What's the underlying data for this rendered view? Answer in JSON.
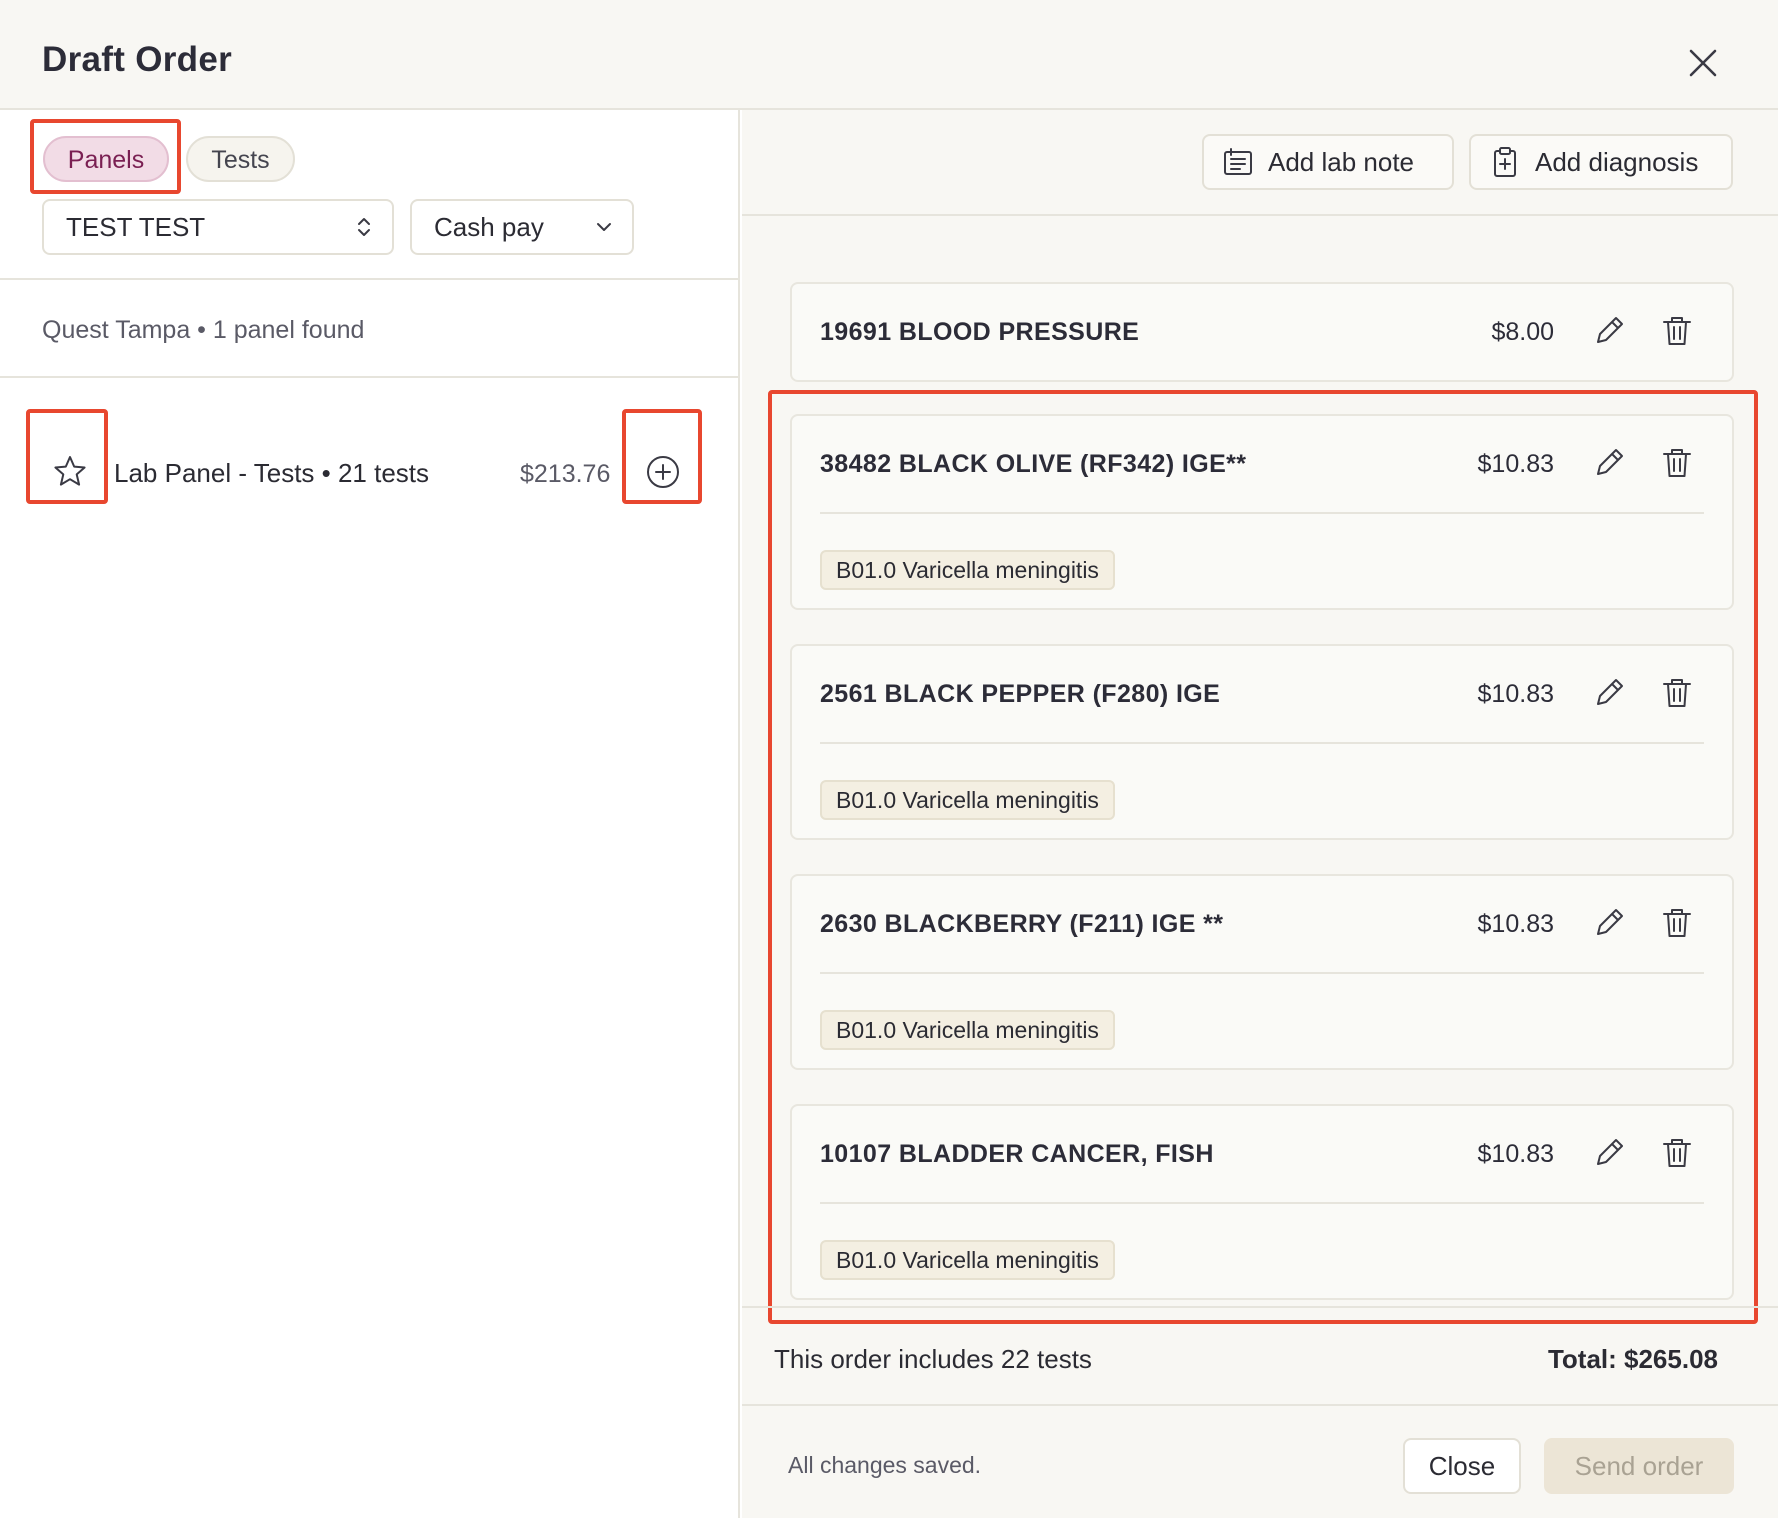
{
  "header": {
    "title": "Draft Order"
  },
  "left": {
    "tabs": [
      {
        "label": "Panels",
        "active": true
      },
      {
        "label": "Tests",
        "active": false
      }
    ],
    "patient_select": {
      "value": "TEST TEST"
    },
    "payment_select": {
      "value": "Cash pay"
    },
    "lab_info": "Quest Tampa • 1 panel found",
    "panels": [
      {
        "name": "Lab Panel - Tests • 21 tests",
        "price": "$213.76"
      }
    ]
  },
  "right": {
    "toolbar": {
      "add_note_label": "Add lab note",
      "add_diagnosis_label": "Add diagnosis"
    },
    "tests": [
      {
        "name": "19691 BLOOD PRESSURE",
        "price": "$8.00"
      },
      {
        "name": "38482 BLACK OLIVE (RF342) IGE**",
        "price": "$10.83",
        "diagnosis": "B01.0 Varicella meningitis"
      },
      {
        "name": "2561 BLACK PEPPER (F280) IGE",
        "price": "$10.83",
        "diagnosis": "B01.0 Varicella meningitis"
      },
      {
        "name": "2630 BLACKBERRY (F211) IGE **",
        "price": "$10.83",
        "diagnosis": "B01.0 Varicella meningitis"
      },
      {
        "name": "10107 BLADDER CANCER, FISH",
        "price": "$10.83",
        "diagnosis": "B01.0 Varicella meningitis"
      }
    ],
    "summary": {
      "count_text": "This order includes 22 tests",
      "total_text": "Total: $265.08"
    },
    "footer": {
      "status": "All changes saved.",
      "close_label": "Close",
      "send_label": "Send order"
    }
  },
  "colors": {
    "highlight": "#e8472f",
    "active_pill_bg": "#f2dce6",
    "active_pill_text": "#7a1f52",
    "tag_bg": "#f4efe2"
  },
  "icons": [
    "close-icon",
    "chevron-updown-icon",
    "chevron-down-icon",
    "star-icon",
    "plus-circle-icon",
    "note-icon",
    "clipboard-plus-icon",
    "pencil-icon",
    "trash-icon"
  ]
}
